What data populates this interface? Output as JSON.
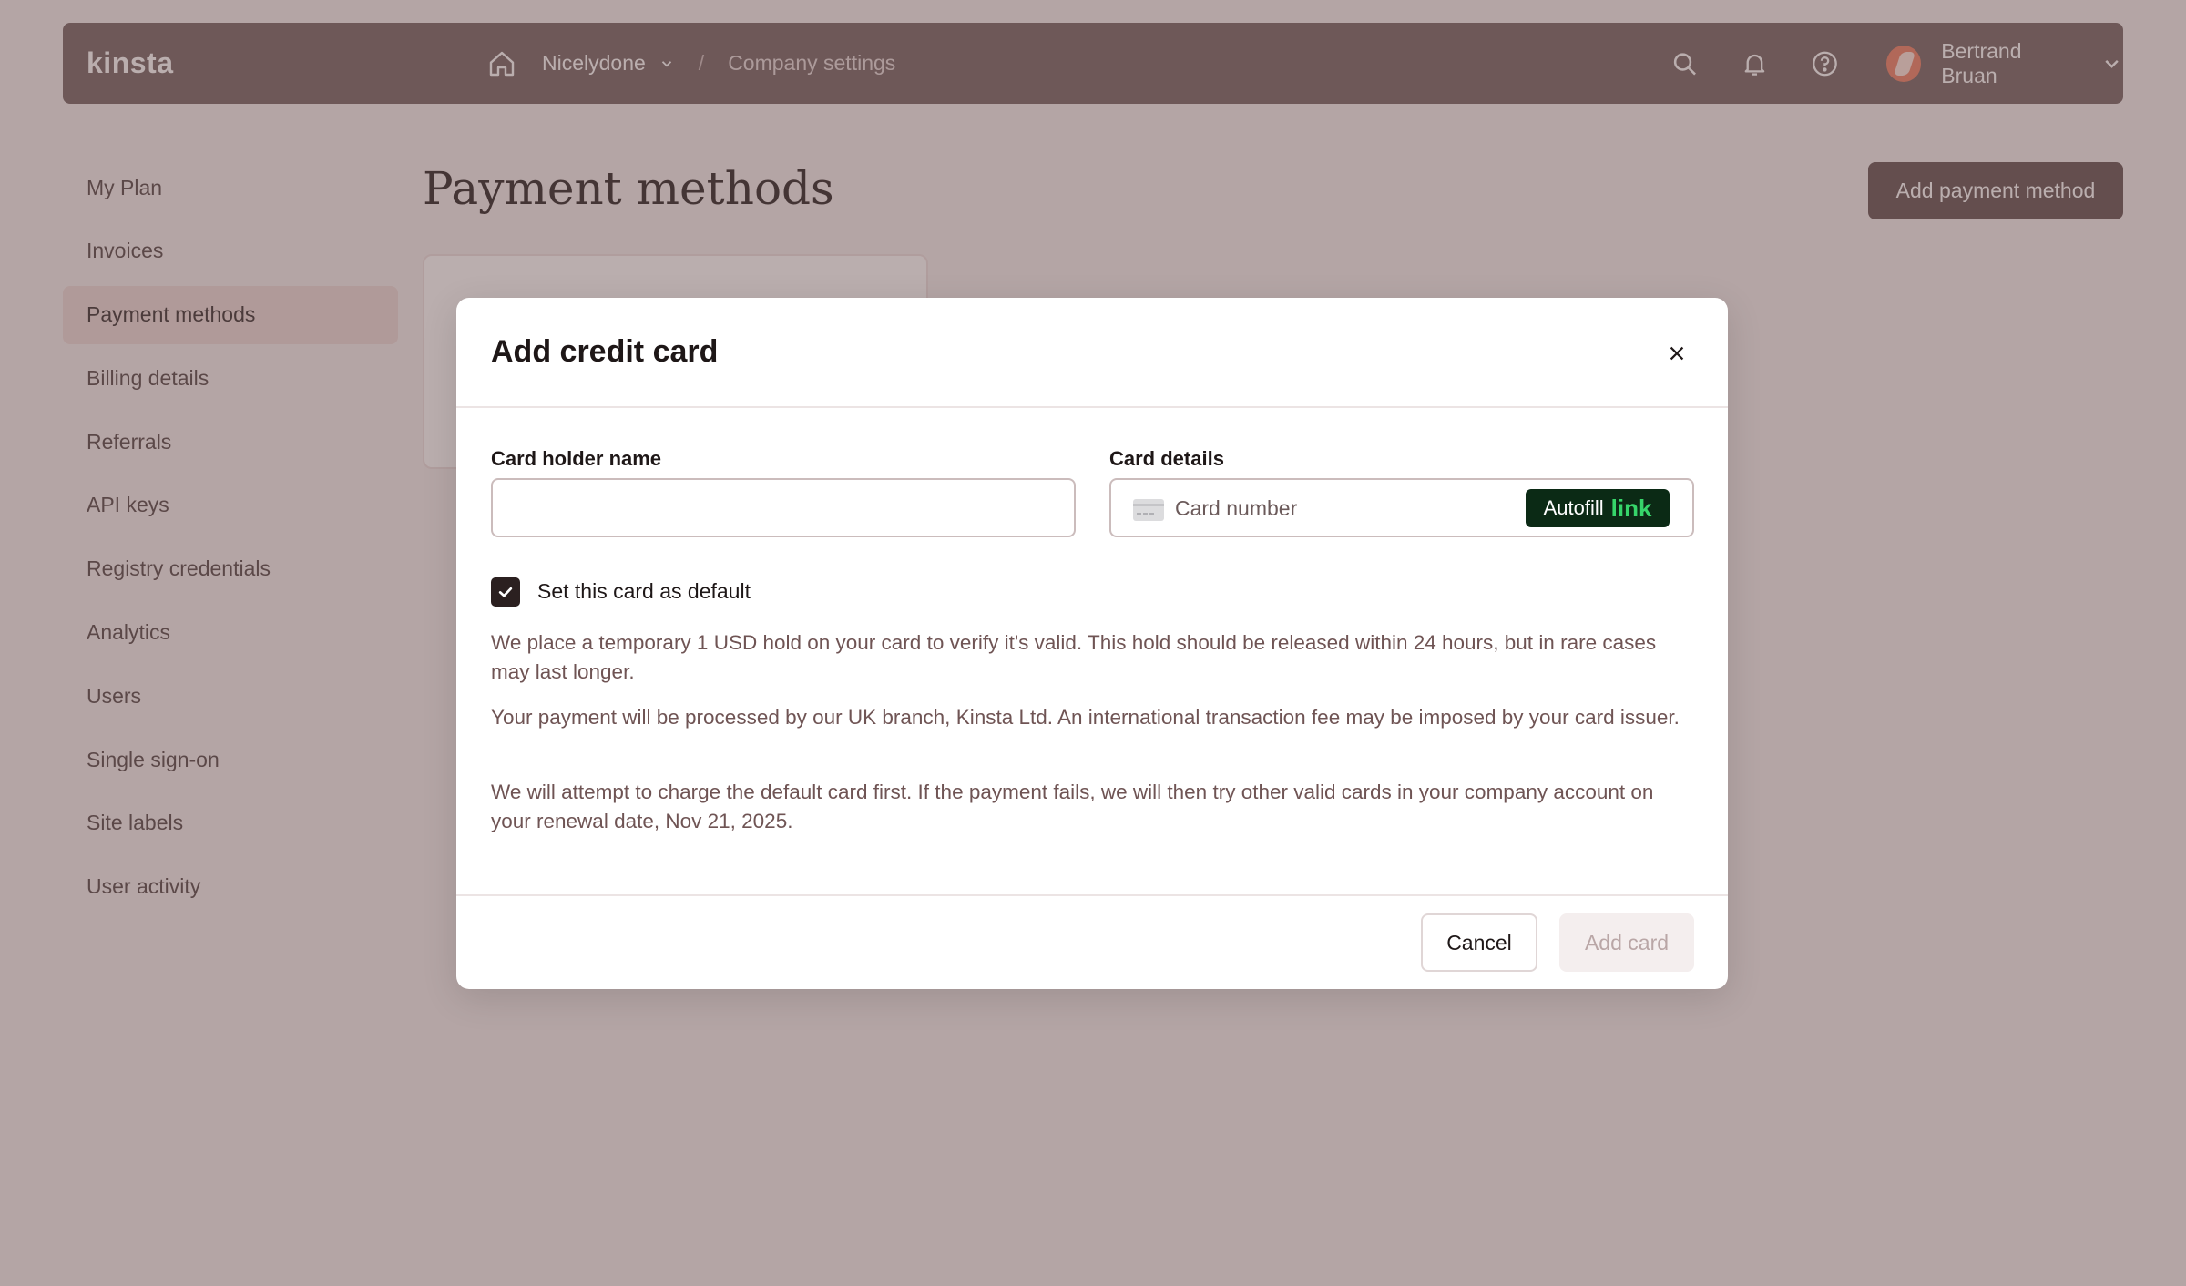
{
  "topbar": {
    "logo": "kinsta",
    "icons": [
      "home-icon",
      "chevron-down-icon",
      "search-icon",
      "bell-icon",
      "help-icon",
      "chevron-down-icon"
    ],
    "company": "Nicelydone",
    "separator": "/",
    "current": "Company settings",
    "user_name": "Bertrand Bruan"
  },
  "sidebar": {
    "items": [
      {
        "label": "My Plan"
      },
      {
        "label": "Invoices"
      },
      {
        "label": "Payment methods",
        "active": true
      },
      {
        "label": "Billing details"
      },
      {
        "label": "Referrals"
      },
      {
        "label": "API keys"
      },
      {
        "label": "Registry credentials"
      },
      {
        "label": "Analytics"
      },
      {
        "label": "Users"
      },
      {
        "label": "Single sign-on"
      },
      {
        "label": "Site labels"
      },
      {
        "label": "User activity"
      }
    ]
  },
  "main": {
    "title": "Payment methods",
    "add_button": "Add payment method"
  },
  "modal": {
    "title": "Add credit card",
    "card_holder_label": "Card holder name",
    "card_holder_value": "",
    "card_details_label": "Card details",
    "card_number_placeholder": "Card number",
    "autofill_text": "Autofill",
    "autofill_brand": "link",
    "default_checked": true,
    "default_label": "Set this card as default",
    "paragraphs": [
      "We place a temporary 1 USD hold on your card to verify it's valid. This hold should be released within 24 hours, but in rare cases may last longer.",
      "Your payment will be processed by our UK branch, Kinsta Ltd. An international transaction fee may be imposed by your card issuer.",
      "We will attempt to charge the default card first. If the payment fails, we will then try other valid cards in your company account on your renewal date, Nov 21, 2025."
    ],
    "cancel_label": "Cancel",
    "add_label": "Add card"
  },
  "colors": {
    "topbar_bg": "#6e5b5b",
    "primary_button": "#5b4848",
    "active_nav": "#ecd9d6",
    "link_brand": "#36d56a"
  }
}
